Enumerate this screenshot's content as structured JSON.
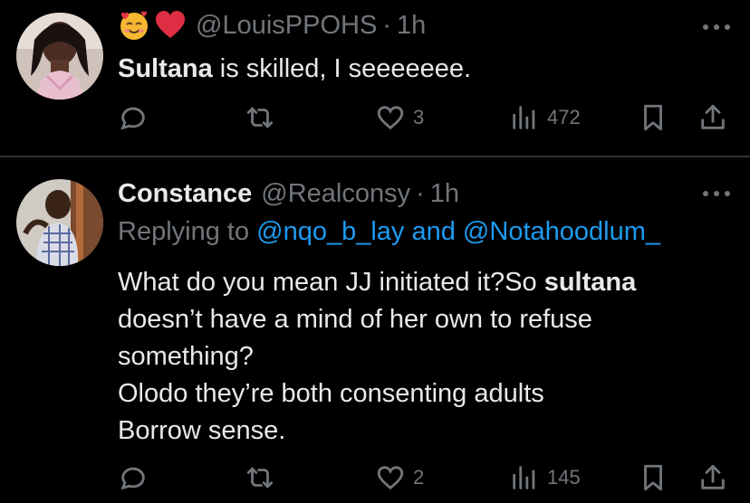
{
  "tweets": [
    {
      "emojis": [
        "smiling-face-with-hearts",
        "red-heart"
      ],
      "handle": "@LouisPPOHS",
      "dot": "·",
      "time": "1h",
      "body_normal": " is skilled, I seeeeeee.",
      "body_bold": "Sultana",
      "likes": "3",
      "views": "472"
    },
    {
      "name": "Constance",
      "handle": "@Realconsy",
      "dot": "·",
      "time": "1h",
      "replying_prefix": "Replying to ",
      "replying_mentions": "@nqo_b_lay and @Notahoodlum_",
      "body_line1_normal": "What do you mean JJ initiated it?So ",
      "body_line1_bold": "sultana",
      "body_rest": "doesn’t have a mind of her own to refuse\nsomething?\nOlodo they’re both consenting adults\nBorrow sense.",
      "likes": "2",
      "views": "145"
    }
  ],
  "colors": {
    "background": "#000000",
    "text": "#e7e9ea",
    "muted": "#71767b",
    "link": "#1d9bf0",
    "divider": "#2f3336"
  },
  "icons": [
    "reply-icon",
    "retweet-icon",
    "like-icon",
    "views-icon",
    "bookmark-icon",
    "share-icon",
    "more-icon"
  ]
}
